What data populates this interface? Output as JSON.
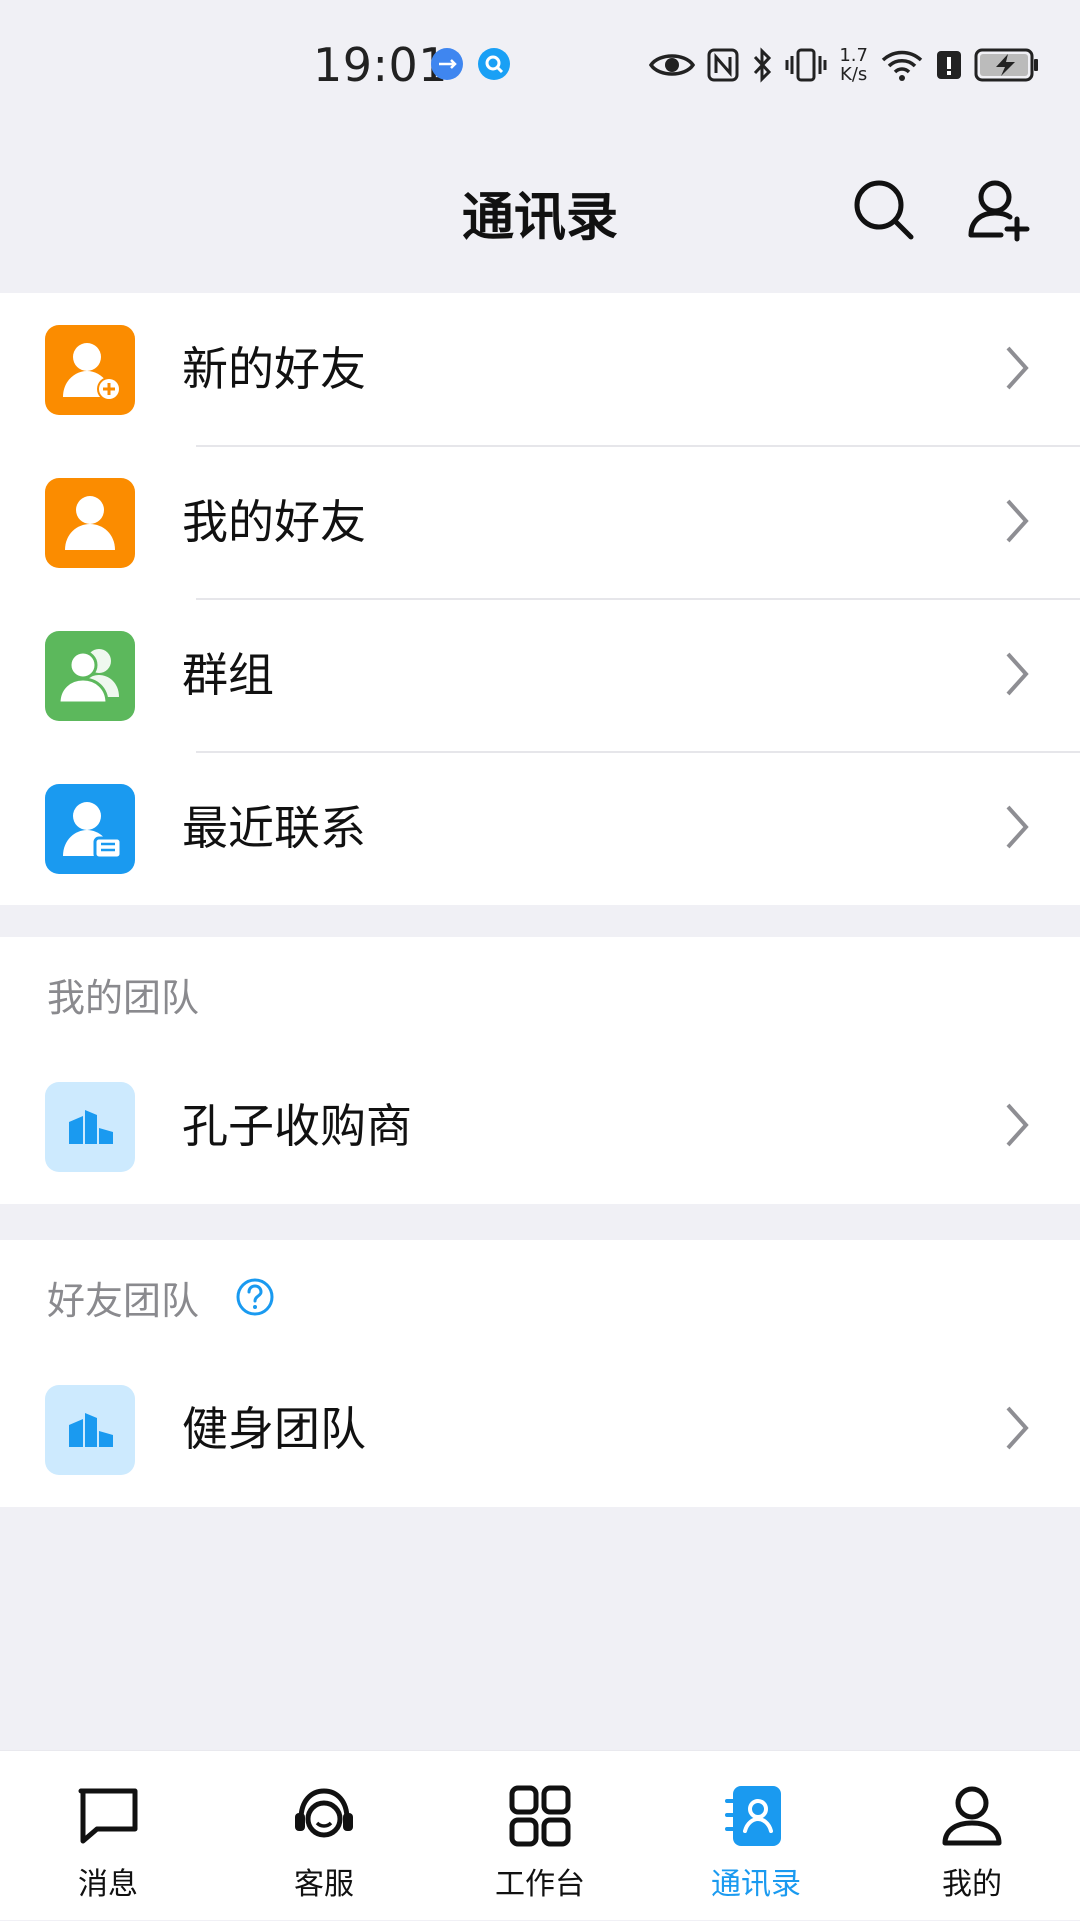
{
  "status_bar": {
    "time": "19:01",
    "network_speed_top": "1.7",
    "network_speed_bottom": "K/s",
    "icons": [
      "usb-icon",
      "search-notify-icon",
      "eye-icon",
      "nfc-icon",
      "bluetooth-icon",
      "vibrate-icon",
      "wifi-icon",
      "alert-icon",
      "battery-charging-icon"
    ]
  },
  "header": {
    "title": "通讯录",
    "search_icon": "search-icon",
    "add_contact_icon": "add-user-icon"
  },
  "main_list": [
    {
      "label": "新的好友",
      "icon": "new-friend-icon",
      "color": "#fb8c00"
    },
    {
      "label": "我的好友",
      "icon": "my-friends-icon",
      "color": "#fb8c00"
    },
    {
      "label": "群组",
      "icon": "group-icon",
      "color": "#5cb85c"
    },
    {
      "label": "最近联系",
      "icon": "recent-contact-icon",
      "color": "#1a9af0"
    }
  ],
  "my_team": {
    "title": "我的团队",
    "items": [
      {
        "label": "孔子收购商",
        "icon": "team-building-icon"
      }
    ]
  },
  "friend_team": {
    "title": "好友团队",
    "help_icon": "help-icon",
    "items": [
      {
        "label": "健身团队",
        "icon": "team-building-icon"
      }
    ]
  },
  "bottom_nav": {
    "active": "通讯录",
    "tabs": [
      {
        "label": "消息",
        "icon": "message-icon"
      },
      {
        "label": "客服",
        "icon": "customer-service-icon"
      },
      {
        "label": "工作台",
        "icon": "workbench-icon"
      },
      {
        "label": "通讯录",
        "icon": "contacts-icon"
      },
      {
        "label": "我的",
        "icon": "profile-icon"
      }
    ]
  },
  "colors": {
    "accent": "#1a9af0",
    "orange": "#fb8c00",
    "green": "#5cb85c",
    "team_icon_bg": "#cdeafe",
    "background": "#f0f0f5"
  }
}
